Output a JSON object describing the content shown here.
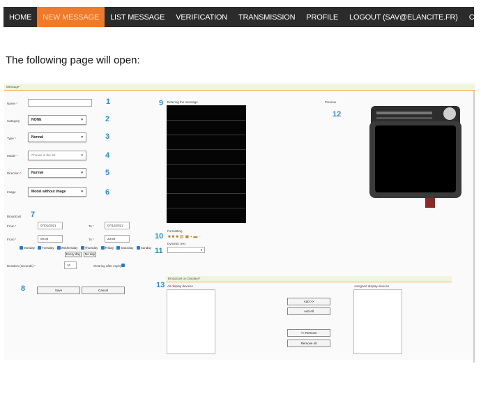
{
  "nav": {
    "items": [
      "HOME",
      "NEW MESSAGE",
      "LIST MESSAGE",
      "VERIFICATION",
      "TRANSMISSION",
      "PROFILE",
      "LOGOUT (SAV@ELANCITE.FR)",
      "CONTACT"
    ],
    "active_index": 1
  },
  "intro_text": "The following page will open:",
  "form": {
    "section_message": "Message",
    "name_label": "Name",
    "category_label": "Category",
    "category_value": "NONE",
    "type_label": "Type",
    "type_value": "Normal",
    "model_label": "Model",
    "model_value": "Choose in the list",
    "direction_label": "Direction",
    "direction_value": "Normal",
    "image_label": "Image",
    "image_value": "Model without Image",
    "broadcast_label": "Broadcast",
    "from_label": "From",
    "from_date": "07/01/2021",
    "to_label": "To",
    "to_date": "07/12/2021",
    "from_time_label": "From",
    "from_time": "00:00",
    "to_time_label": "To",
    "to_time": "23:59",
    "days": [
      "Monday",
      "Tuesday",
      "Wednesday",
      "Thursday",
      "Friday",
      "Saturday",
      "Sunday"
    ],
    "every_day": "Every day",
    "no_day": "No day",
    "duration_label": "Duration (seconds)",
    "duration_value": "10",
    "clearing_label": "Clearing after expiry",
    "save": "Save",
    "cancel": "Cancel",
    "entering_label": "Entering the message",
    "preview_label": "Preview",
    "formatting_label": "Formatting",
    "dynamic_label": "Dynamic text",
    "section_broadcast": "Broadcast on Displays",
    "all_devices_label": "All display devices",
    "assigned_devices_label": "Assigned display devices",
    "add": "Add >>",
    "add_all": "Add All",
    "remove": "<< Remove",
    "remove_all": "Remove All"
  },
  "callouts": [
    "1",
    "2",
    "3",
    "4",
    "5",
    "6",
    "7",
    "8",
    "9",
    "10",
    "11",
    "12",
    "13"
  ],
  "colors": {
    "nav_bg": "#2b2b2b",
    "nav_active": "#f07a2a",
    "callout": "#2a8ccf",
    "section_line": "#f1b04a"
  },
  "icons": [
    "bold-icon",
    "italic-icon",
    "underline-icon",
    "align-icon",
    "image-icon",
    "save-icon",
    "print-icon",
    "lock-icon"
  ]
}
